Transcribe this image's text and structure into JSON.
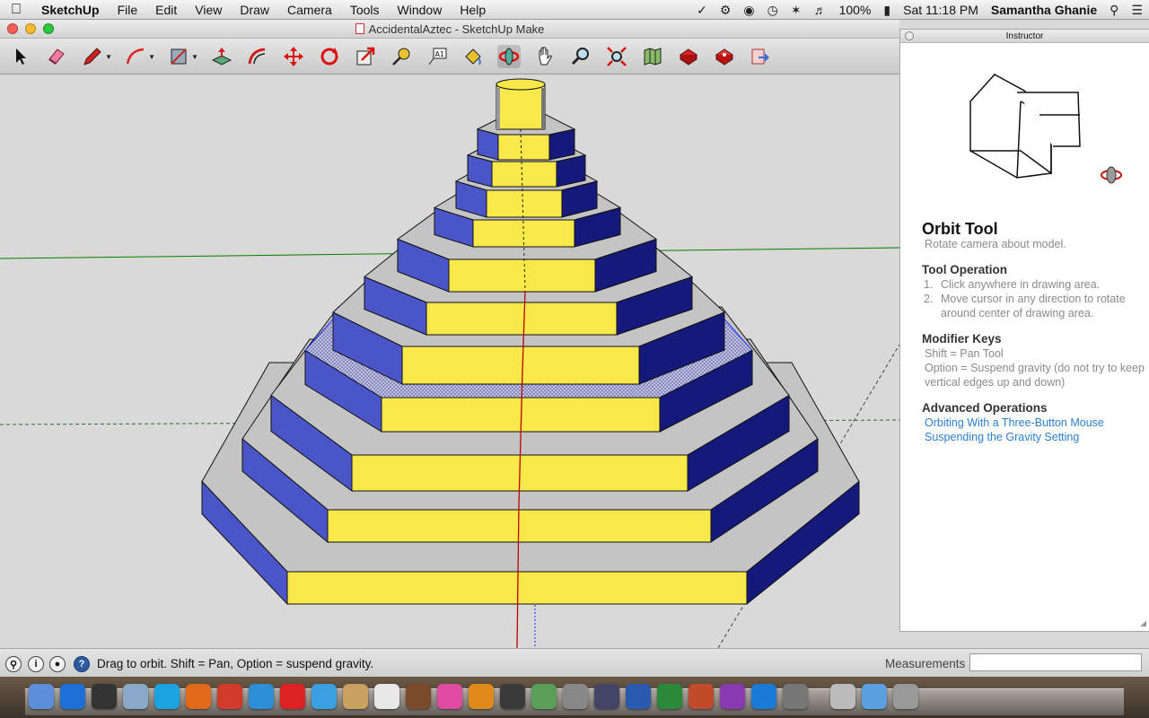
{
  "menubar": {
    "app_name": "SketchUp",
    "items": [
      "File",
      "Edit",
      "View",
      "Draw",
      "Camera",
      "Tools",
      "Window",
      "Help"
    ],
    "battery": "100%",
    "clock": "Sat 11:18 PM",
    "user": "Samantha Ghanie"
  },
  "window": {
    "title": "AccidentalAztec - SketchUp Make"
  },
  "toolbar": {
    "tools": [
      "select",
      "eraser",
      "pencil",
      "arc",
      "rectangle",
      "push-pull",
      "offset",
      "move",
      "rotate",
      "scale",
      "tape-measure",
      "text",
      "paint-bucket",
      "orbit",
      "pan",
      "zoom",
      "zoom-extents",
      "warehouse",
      "extension-warehouse",
      "send-to-layout",
      "export"
    ],
    "active_tool": "orbit"
  },
  "instructor": {
    "panel_title": "Instructor",
    "tool_name": "Orbit Tool",
    "tool_desc": "Rotate camera about model.",
    "operation_heading": "Tool Operation",
    "operation_steps": [
      {
        "n": "1.",
        "text": "Click anywhere in drawing area."
      },
      {
        "n": "2.",
        "text": "Move cursor in any direction to rotate around center of drawing area."
      }
    ],
    "modifier_heading": "Modifier Keys",
    "modifier_1": "Shift = Pan Tool",
    "modifier_2": "Option = Suspend gravity (do not try to keep vertical edges up and down)",
    "advanced_heading": "Advanced Operations",
    "link_1": "Orbiting With a Three-Button Mouse",
    "link_2": "Suspending the Gravity Setting"
  },
  "statusbar": {
    "hint": "Drag to orbit. Shift = Pan, Option = suspend gravity.",
    "measurements_label": "Measurements",
    "measurements_value": ""
  },
  "colors": {
    "step_top": "#c4c4c4",
    "step_front": "#f8e84a",
    "step_left": "#4a55c8",
    "step_right": "#151a7a",
    "selection": "#1a2cff",
    "axis_red": "#c00000",
    "axis_green": "#008000"
  },
  "dock": {
    "apps": [
      "finder",
      "launchpad",
      "dashboard",
      "preview",
      "skype",
      "firefox",
      "chrome",
      "safari",
      "sketchup",
      "messages",
      "contacts",
      "calendar",
      "garageband",
      "itunes",
      "ibooks",
      "photo-booth",
      "iphoto",
      "system-preferences",
      "time-machine",
      "word",
      "excel",
      "powerpoint",
      "onenote",
      "lync",
      "tools",
      "documents",
      "downloads",
      "trash"
    ]
  }
}
